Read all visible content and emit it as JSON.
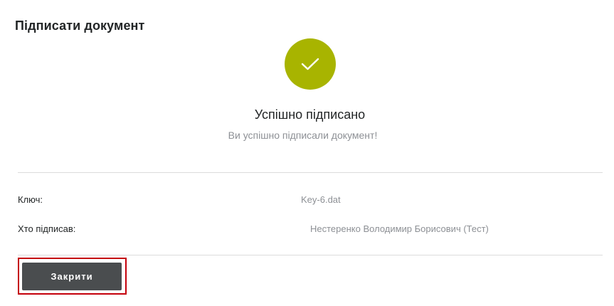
{
  "dialog": {
    "title": "Підписати документ"
  },
  "status": {
    "icon": "checkmark-icon",
    "color": "#a8b400",
    "title": "Успішно підписано",
    "message": "Ви успішно підписали документ!"
  },
  "details": [
    {
      "label": "Ключ:",
      "value": "Key-6.dat"
    },
    {
      "label": "Хто підписав:",
      "value": "Нестеренко Володимир Борисович (Тест)"
    }
  ],
  "actions": {
    "close_label": "Закрити",
    "highlight_color": "#c4000b"
  }
}
